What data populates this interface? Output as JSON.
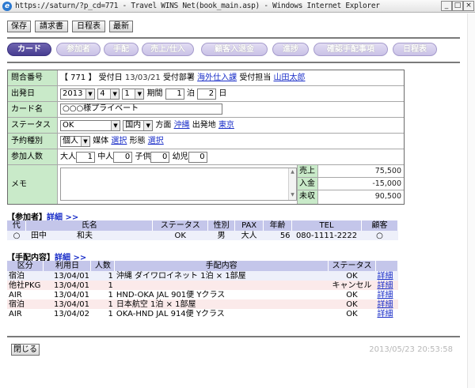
{
  "window": {
    "url": "https://saturn/?p_cd=771",
    "title_sep": " - ",
    "app_title": "Travel WINS Net(book_main.asp) - Windows Internet Explorer"
  },
  "toolbar": {
    "save": "保存",
    "invoice": "請求書",
    "itinerary": "日程表",
    "latest": "最新"
  },
  "tabs": [
    "カード",
    "参加者",
    "手配",
    "売上/仕入",
    "顧客入退金",
    "進捗",
    "確認手配事項",
    "日程表"
  ],
  "card": {
    "inquiry_label": "問合番号",
    "inquiry_no": "【 771 】",
    "received_date_label": "受付日",
    "received_date": "13/03/21",
    "dept_label": "受付部署",
    "dept": "海外仕入課",
    "staff_label": "受付担当",
    "staff": "山田太郎",
    "departure_label": "出発日",
    "dep_year": "2013",
    "dep_month": "4",
    "dep_day": "1",
    "period_label": "期間",
    "nights": "1",
    "nights_unit": "泊",
    "days": "2",
    "days_unit": "日",
    "card_name_label": "カード名",
    "card_name": "○○○様プライベート",
    "status_label": "ステータス",
    "status_value": "OK",
    "region_value": "国内",
    "direction_label": "方面",
    "direction": "沖縄",
    "origin_label": "出発地",
    "origin": "東京",
    "booking_type_label": "予約種別",
    "booking_type": "個人",
    "media_label": "媒体",
    "media_select": "選択",
    "form_label": "形態",
    "form_select": "選択",
    "participants_label": "参加人数",
    "adult_label": "大人",
    "adult": "1",
    "child_label": "中人",
    "child": "0",
    "kid_label": "子供",
    "kid": "0",
    "infant_label": "幼児",
    "infant": "0",
    "memo_label": "メモ",
    "memo": "",
    "sales_label": "売上",
    "sales": "75,500",
    "deposit_label": "入金",
    "deposit": "-15,000",
    "unpaid_label": "未収",
    "unpaid": "90,500"
  },
  "participants": {
    "title": "【参加者】",
    "detail_link": "詳細 >>",
    "headers": [
      "代",
      "氏名",
      "ステータス",
      "性別",
      "PAX",
      "年齢",
      "TEL",
      "顧客"
    ],
    "rows": [
      {
        "rep": "○",
        "surname": "田中",
        "given": "和夫",
        "status": "OK",
        "gender": "男",
        "pax": "大人",
        "age": "56",
        "tel": "080-1111-2222",
        "customer": "○"
      }
    ]
  },
  "arrangements": {
    "title": "【手配内容】",
    "detail_link": "詳細 >>",
    "headers": [
      "区分",
      "利用日",
      "人数",
      "手配内容",
      "ステータス",
      ""
    ],
    "rows": [
      {
        "type": "宿泊",
        "date": "13/04/01",
        "count": "1",
        "content": "沖縄 ダイワロイネット 1泊 × 1部屋",
        "status": "OK",
        "link": "詳細"
      },
      {
        "type": "他社PKG",
        "date": "13/04/01",
        "count": "1",
        "content": "",
        "status": "キャンセル",
        "link": "詳細"
      },
      {
        "type": "AIR",
        "date": "13/04/01",
        "count": "1",
        "content": "HND-OKA JAL 901便 Yクラス",
        "status": "OK",
        "link": "詳細"
      },
      {
        "type": "宿泊",
        "date": "13/04/01",
        "count": "1",
        "content": "日本航空 1泊 × 1部屋",
        "status": "OK",
        "link": "詳細"
      },
      {
        "type": "AIR",
        "date": "13/04/02",
        "count": "1",
        "content": "OKA-HND JAL 914便 Yクラス",
        "status": "OK",
        "link": "詳細"
      }
    ]
  },
  "footer": {
    "close": "閉じる",
    "timestamp": "2013/05/23 20:53:58"
  }
}
